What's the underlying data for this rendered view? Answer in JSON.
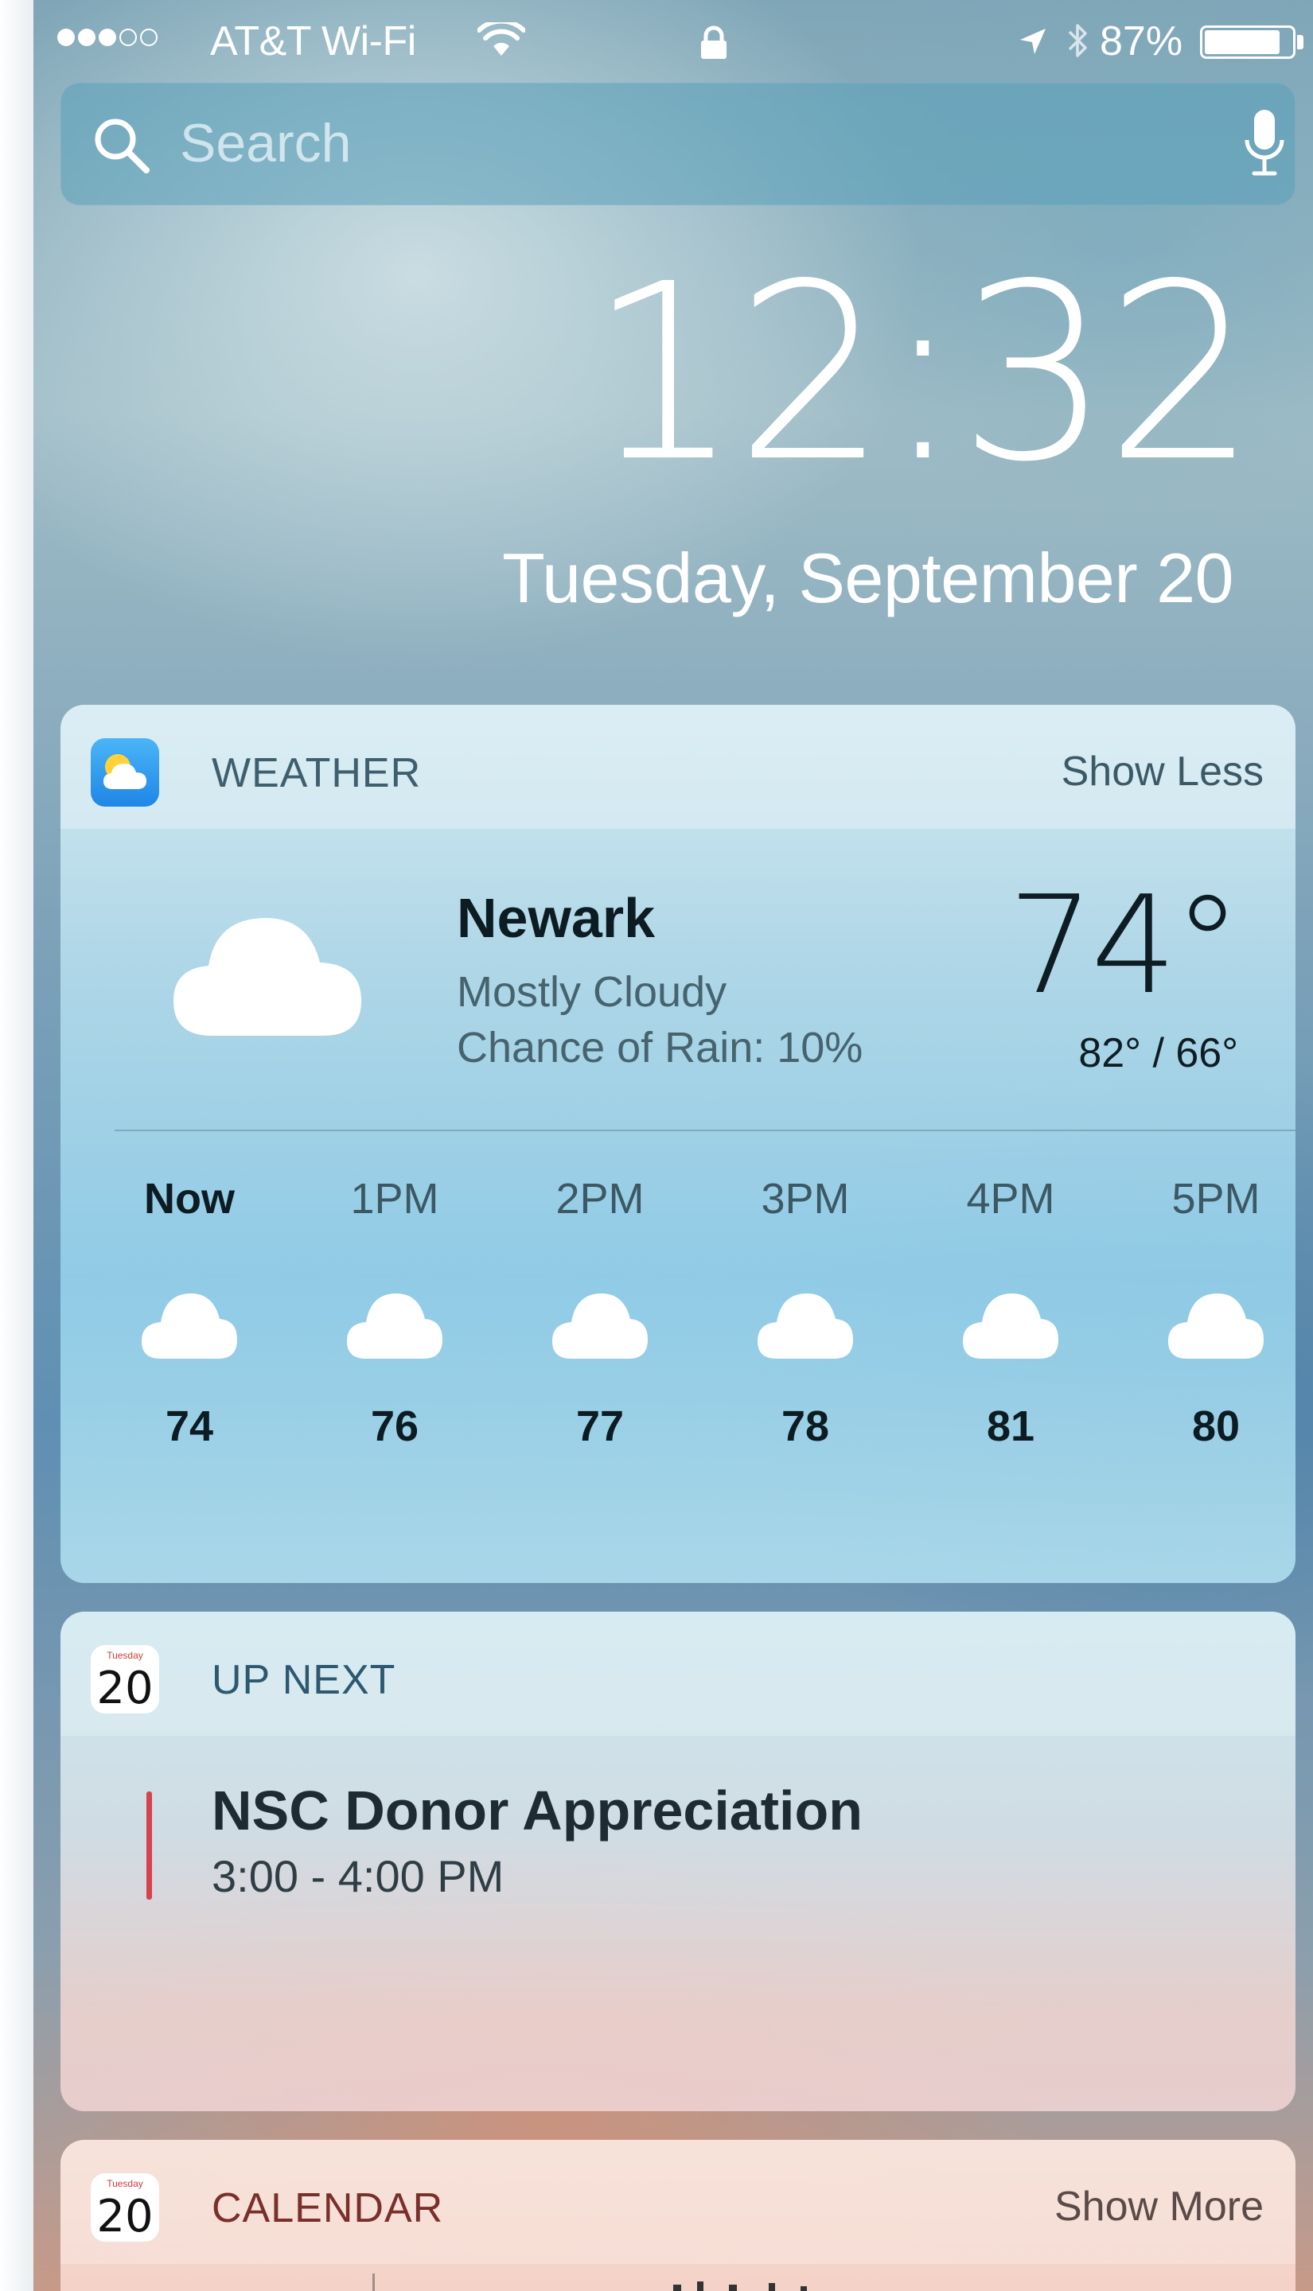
{
  "status_bar": {
    "carrier": "AT&T Wi-Fi",
    "signal_bars_filled": 3,
    "signal_bars_total": 5,
    "battery_percent": "87%",
    "battery_level": 0.87
  },
  "search": {
    "placeholder": "Search"
  },
  "lock_screen": {
    "time": "12:32",
    "date": "Tuesday, September 20"
  },
  "weather_widget": {
    "title": "WEATHER",
    "action": "Show Less",
    "city": "Newark",
    "condition": "Mostly Cloudy",
    "rain": "Chance of Rain: 10%",
    "temperature": "74°",
    "high_low": "82° / 66°",
    "hourly": [
      {
        "label": "Now",
        "temp": "74",
        "icon": "cloud-icon"
      },
      {
        "label": "1PM",
        "temp": "76",
        "icon": "cloud-icon"
      },
      {
        "label": "2PM",
        "temp": "77",
        "icon": "cloud-icon"
      },
      {
        "label": "3PM",
        "temp": "78",
        "icon": "cloud-icon"
      },
      {
        "label": "4PM",
        "temp": "81",
        "icon": "cloud-icon"
      },
      {
        "label": "5PM",
        "temp": "80",
        "icon": "cloud-icon"
      }
    ]
  },
  "up_next_widget": {
    "title": "UP NEXT",
    "icon_day": "20",
    "icon_weekday": "Tuesday",
    "event_title": "NSC Donor Appreciation",
    "event_time": "3:00 - 4:00 PM",
    "event_color": "#d6424e"
  },
  "calendar_widget": {
    "title": "CALENDAR",
    "action": "Show More",
    "icon_day": "20",
    "icon_weekday": "Tuesday"
  },
  "colors": {
    "weather_icon_bg": "#2f9bf0",
    "calendar_title": "#7a2f2b",
    "up_next_title": "#2d5870"
  }
}
